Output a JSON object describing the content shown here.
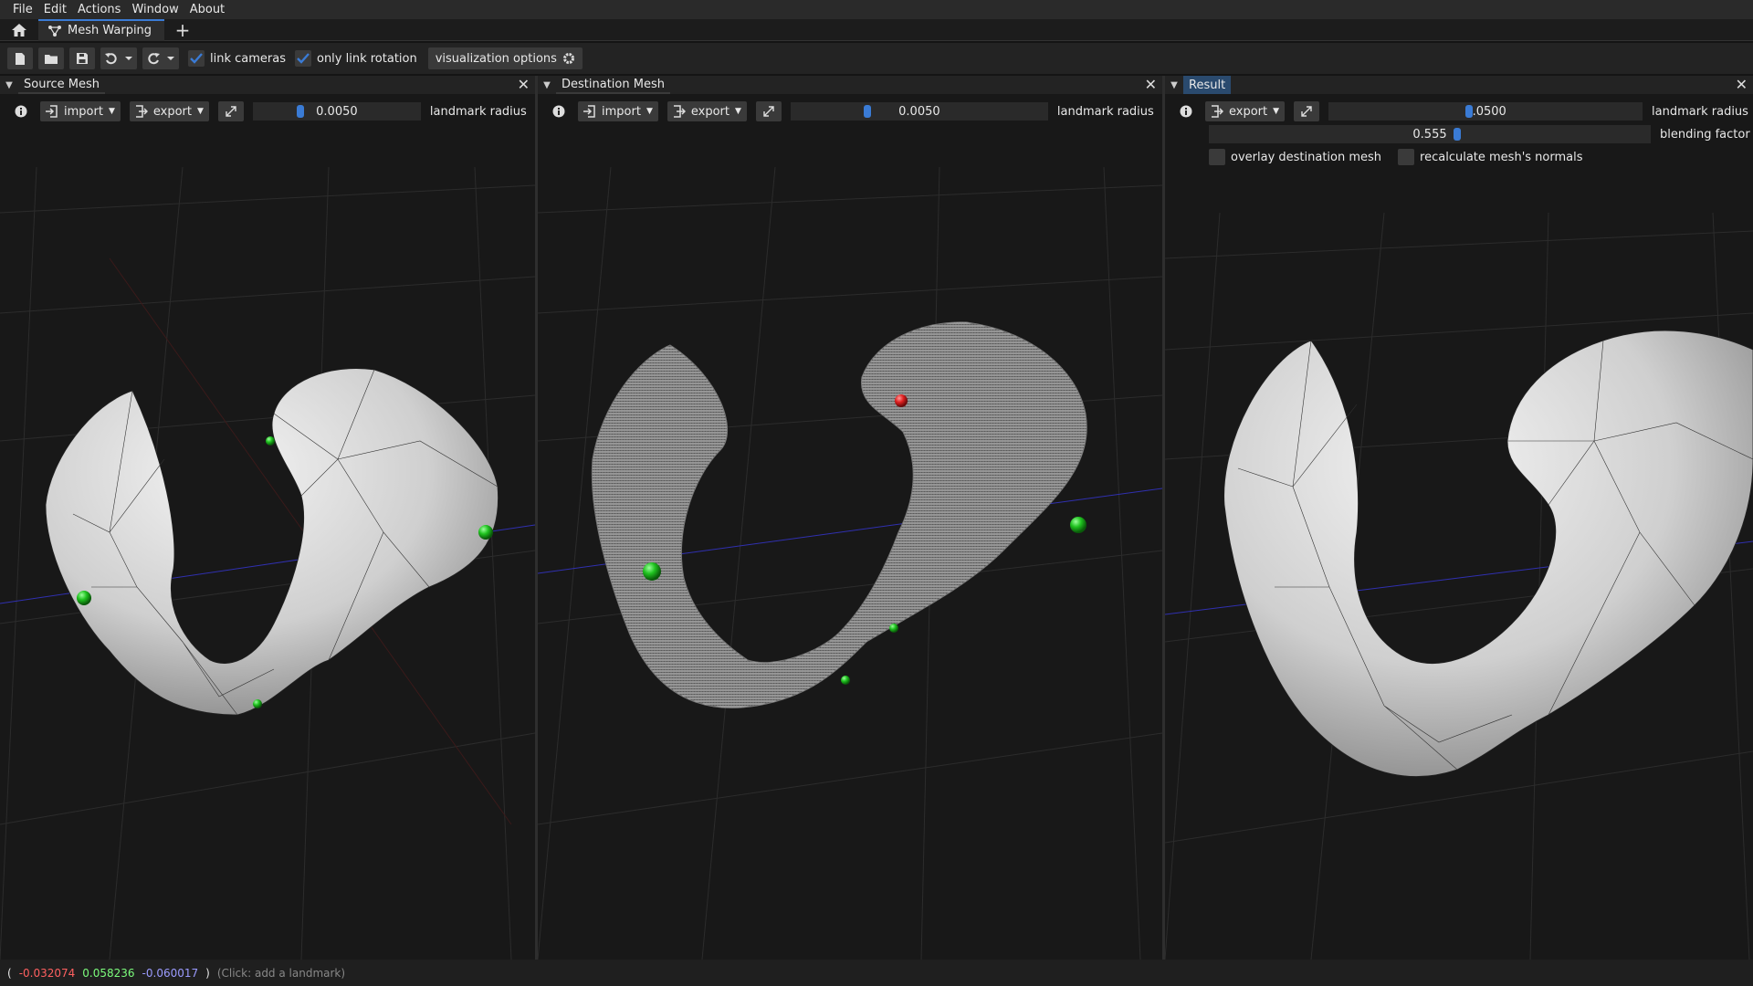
{
  "menu": [
    "File",
    "Edit",
    "Actions",
    "Window",
    "About"
  ],
  "tab": {
    "label": "Mesh Warping",
    "add": "+"
  },
  "toolbar": {
    "link_cameras": "link cameras",
    "link_cameras_checked": true,
    "only_link_rotation": "only link rotation",
    "only_link_rotation_checked": true,
    "visualization_options": "visualization options"
  },
  "panels": {
    "source": {
      "title": "Source Mesh",
      "import": "import",
      "export": "export",
      "radius_value": "0.0050",
      "radius_label": "landmark radius"
    },
    "destination": {
      "title": "Destination Mesh",
      "import": "import",
      "export": "export",
      "radius_value": "0.0050",
      "radius_label": "landmark radius"
    },
    "result": {
      "title": "Result",
      "export": "export",
      "radius_value": "0.0500",
      "radius_label": "landmark radius",
      "blending_value": "0.555",
      "blending_label": "blending factor",
      "overlay": "overlay destination mesh",
      "recalc": "recalculate mesh's normals"
    }
  },
  "status": {
    "open": "(",
    "x": "-0.032074",
    "y": "0.058236",
    "z": "-0.060017",
    "close": ")",
    "hint": "(Click: add a landmark)"
  },
  "colors": {
    "accent": "#3a7bd5",
    "landmark": "#1fc21f",
    "selected_landmark": "#e02020"
  }
}
